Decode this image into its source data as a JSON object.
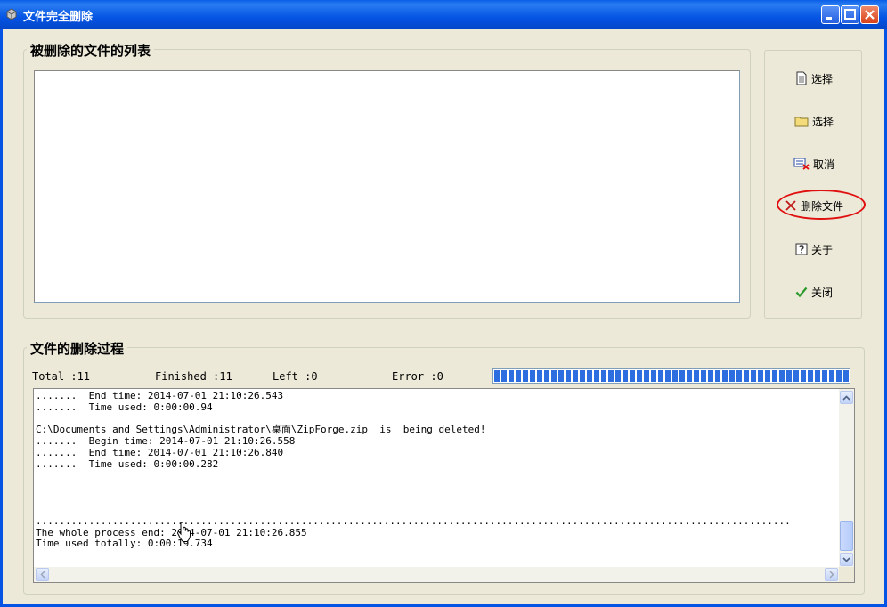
{
  "window": {
    "title": "文件完全删除"
  },
  "list_section": {
    "title": "被删除的文件的列表"
  },
  "actions": {
    "select_file": "选择",
    "select_folder": "选择",
    "cancel": "取消",
    "delete_files": "删除文件",
    "about": "关于",
    "close": "关闭"
  },
  "process_section": {
    "title": "文件的删除过程"
  },
  "stats": {
    "total": "Total :11",
    "finished": "Finished :11",
    "left": "Left :0",
    "error": "Error :0"
  },
  "progress": {
    "fraction": 1.0
  },
  "log": {
    "lines": [
      ".......  End time: 2014-07-01 21:10:26.543",
      ".......  Time used: 0:00:00.94",
      "",
      "C:\\Documents and Settings\\Administrator\\桌面\\ZipForge.zip  is  being deleted!",
      ".......  Begin time: 2014-07-01 21:10:26.558",
      ".......  End time: 2014-07-01 21:10:26.840",
      ".......  Time used: 0:00:00.282",
      "",
      "",
      "",
      "",
      "................................................................................................................................",
      "The whole process end: 2014-07-01 21:10:26.855",
      "Time used totally: 0:00:19.734"
    ]
  },
  "colors": {
    "accent": "#2c6ee0",
    "highlight": "#e01010"
  }
}
